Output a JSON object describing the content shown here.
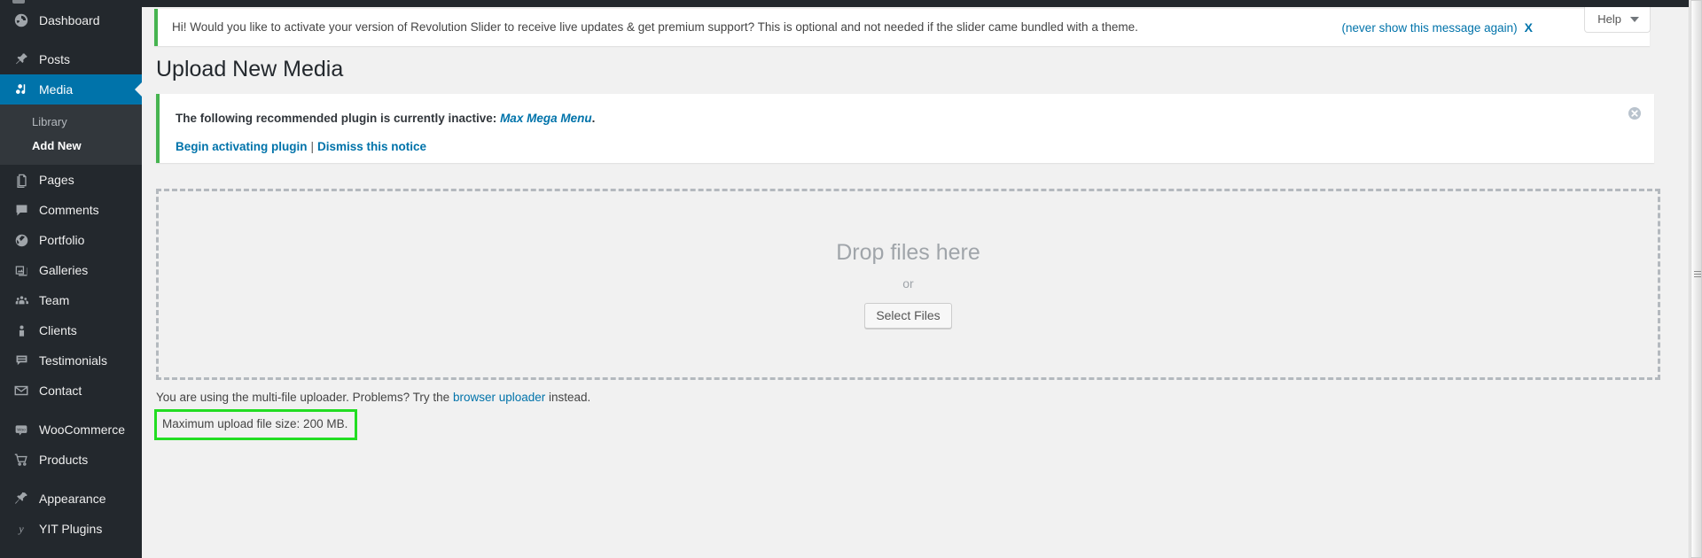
{
  "sidebar": {
    "items": [
      {
        "label": "Dashboard",
        "icon": "dashboard-icon",
        "current": false
      },
      {
        "label": "Posts",
        "icon": "pin-icon",
        "current": false
      },
      {
        "label": "Media",
        "icon": "media-icon",
        "current": true
      },
      {
        "label": "Pages",
        "icon": "pages-icon",
        "current": false
      },
      {
        "label": "Comments",
        "icon": "comments-icon",
        "current": false
      },
      {
        "label": "Portfolio",
        "icon": "portfolio-icon",
        "current": false
      },
      {
        "label": "Galleries",
        "icon": "galleries-icon",
        "current": false
      },
      {
        "label": "Team",
        "icon": "team-icon",
        "current": false
      },
      {
        "label": "Clients",
        "icon": "clients-icon",
        "current": false
      },
      {
        "label": "Testimonials",
        "icon": "testimonials-icon",
        "current": false
      },
      {
        "label": "Contact",
        "icon": "contact-icon",
        "current": false
      },
      {
        "label": "WooCommerce",
        "icon": "woocommerce-icon",
        "current": false
      },
      {
        "label": "Products",
        "icon": "products-cart-icon",
        "current": false
      },
      {
        "label": "Appearance",
        "icon": "appearance-brush-icon",
        "current": false
      },
      {
        "label": "YIT Plugins",
        "icon": "yit-plugins-icon",
        "current": false
      }
    ],
    "media_submenu": [
      {
        "label": "Library",
        "current": false
      },
      {
        "label": "Add New",
        "current": true
      }
    ],
    "active_color": "#0073aa"
  },
  "help_tab": {
    "label": "Help",
    "caret": "chevron-down-icon"
  },
  "revolution_notice": {
    "message": "Hi! Would you like to activate your version of Revolution Slider to receive live updates & get premium support? This is optional and not needed if the slider came bundled with a theme.",
    "never_show_label": "(never show this message again)",
    "close_label": "X",
    "accent_color": "#46b450"
  },
  "page": {
    "title": "Upload New Media"
  },
  "plugin_notice": {
    "line1_prefix": "The following recommended plugin is currently inactive: ",
    "plugin_name": "Max Mega Menu",
    "line1_suffix": ".",
    "activate_label": "Begin activating plugin",
    "separator": "|",
    "dismiss_label": "Dismiss this notice",
    "close_icon": "dismiss-circle-x-icon",
    "accent_color": "#46b450"
  },
  "dropzone": {
    "drop_text": "Drop files here",
    "or_text": "or",
    "select_button": "Select Files",
    "border_color": "#b4b9be"
  },
  "footer": {
    "uploader_prefix": "You are using the multi-file uploader. Problems? Try the ",
    "uploader_link": "browser uploader",
    "uploader_suffix": " instead.",
    "max_upload": "Maximum upload file size: 200 MB.",
    "highlight_color": "#22dd22"
  }
}
